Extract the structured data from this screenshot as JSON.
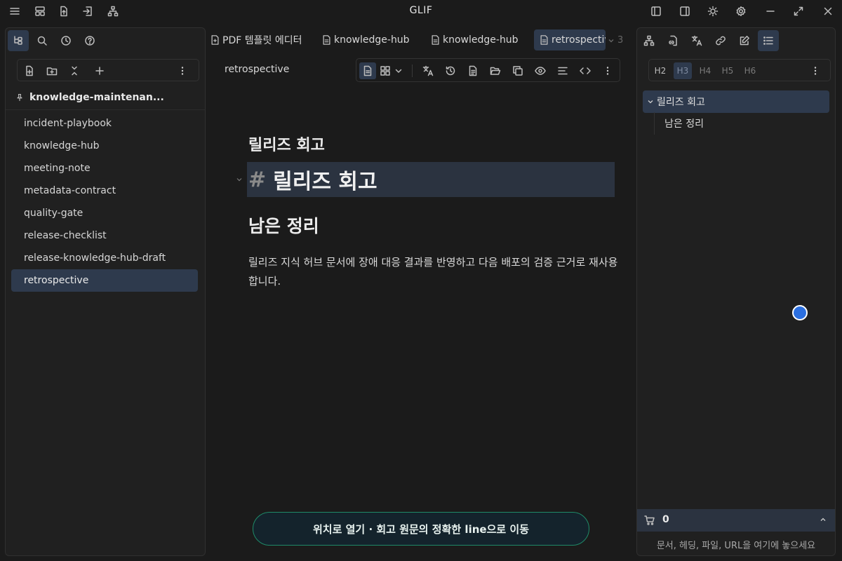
{
  "app": {
    "title": "GLIF"
  },
  "titlebar": {
    "left_icons": [
      "menu-icon",
      "layout-icon",
      "file-upload-icon",
      "sign-in-icon",
      "sitemap-icon"
    ],
    "right_icons": [
      "sidebar-left-icon",
      "sidebar-right-icon",
      "sun-icon",
      "gear-icon",
      "minimize-icon",
      "maximize-icon",
      "close-icon"
    ]
  },
  "left_panel": {
    "tabs": [
      "file-tree-icon",
      "search-icon",
      "history-icon",
      "help-icon"
    ],
    "toolbar_icons": [
      "new-file-icon",
      "new-folder-icon",
      "collapse-all-icon",
      "plus-icon",
      "more-vertical-icon"
    ],
    "root_label": "knowledge-maintenan...",
    "root_icon": "pin-icon",
    "files": [
      "incident-playbook",
      "knowledge-hub",
      "meeting-note",
      "metadata-contract",
      "quality-gate",
      "release-checklist",
      "release-knowledge-hub-draft",
      "retrospective"
    ],
    "active_file": "retrospective"
  },
  "tabs": [
    {
      "label": "PDF 템플릿 에디터",
      "icon": "file-pdf-icon"
    },
    {
      "label": "knowledge-hub",
      "icon": "file-icon"
    },
    {
      "label": "knowledge-hub",
      "icon": "file-icon"
    },
    {
      "label": "retrospective",
      "icon": "file-icon",
      "active": true
    }
  ],
  "tab_overflow_count": "3",
  "document": {
    "name": "retrospective",
    "toolbar_icons": [
      "document-icon",
      "grid-icon",
      "chevron-down-icon",
      "translate-icon",
      "history-icon",
      "file-text-icon",
      "folder-open-icon",
      "copy-icon",
      "eye-icon",
      "align-icon",
      "code-icon",
      "more-vertical-icon"
    ],
    "heading_rendered": "릴리즈 회고",
    "heading_source_hash": "#",
    "heading_source_text": "릴리즈 회고",
    "subheading": "남은 정리",
    "paragraph": "릴리즈 지식 허브 문서에 장애 대응 결과를 반영하고 다음 배포의 검증 근거로 재사용합니다."
  },
  "banner": {
    "text": "위치로 열기 · 회고 원문의 정확한 line으로 이동"
  },
  "right_panel": {
    "tabs": [
      "graph-icon",
      "file-link-icon",
      "translate-icon",
      "link-icon",
      "edit-icon",
      "outline-list-icon"
    ],
    "levels": [
      "H2",
      "H3",
      "H4",
      "H5",
      "H6"
    ],
    "active_level": "H3",
    "outline": [
      {
        "label": "릴리즈 회고",
        "children": [
          "남은 정리"
        ]
      }
    ],
    "cart_count": "0",
    "drop_hint": "문서, 헤딩, 파일, URL을 여기에 놓으세요",
    "status_color": "#2b6fe0"
  }
}
